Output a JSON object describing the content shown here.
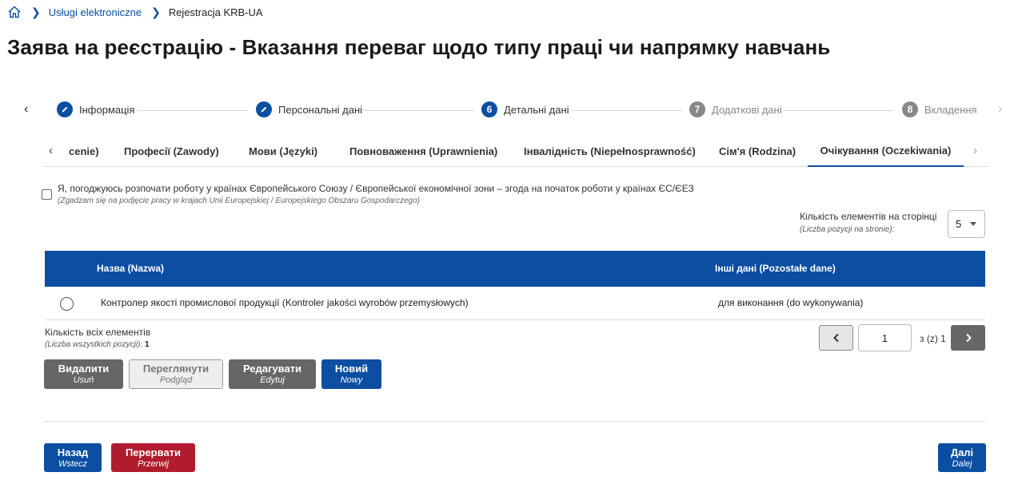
{
  "breadcrumb": {
    "items": [
      "Usługi elektroniczne",
      "Rejestracja KRB-UA"
    ]
  },
  "page_title": "Заява на реєстрацію - Вказання переваг щодо типу праці чи напрямку навчань",
  "stepper": {
    "steps": [
      {
        "num": "",
        "label": "Інформація",
        "state": "done"
      },
      {
        "num": "",
        "label": "Персональні дані",
        "state": "done"
      },
      {
        "num": "6",
        "label": "Детальні дані",
        "state": "active"
      },
      {
        "num": "7",
        "label": "Додаткові дані",
        "state": "pending"
      },
      {
        "num": "8",
        "label": "Вкладення",
        "state": "pending"
      }
    ]
  },
  "tabs": {
    "items": [
      "cenie)",
      "Професії (Zawody)",
      "Мови (Języki)",
      "Повноваження (Uprawnienia)",
      "Інвалідність (Niepełnosprawność)",
      "Сім'я (Rodzina)",
      "Очікування (Oczekiwania)"
    ],
    "active_index": 6
  },
  "consent": {
    "label": "Я, погоджуюсь розпочати роботу у країнах Європейського Союзу / Європейської економічної зони – згода на початок роботи у країнах ЄС/ЄЕЗ",
    "label_pl": "(Zgadzam się na podjęcie pracy w krajach Unii Europejskiej / Europejskiego Obszaru Gospodarczego)",
    "checked": false
  },
  "per_page": {
    "label": "Кількість елементів на сторінці",
    "label_pl": "(Liczba pozycji na stronie):",
    "value": "5"
  },
  "table": {
    "columns": [
      "Назва (Nazwa)",
      "Інші дані (Pozostałe dane)"
    ],
    "rows": [
      {
        "name": "Контролер якості промислової продукції (Kontroler jakości wyrobów przemysłowych)",
        "other": "для виконання (do wykonywania)"
      }
    ]
  },
  "total": {
    "label": "Кількість всіх елементів",
    "label_pl": "(Liczba wszystkich pozycji):",
    "count": "1"
  },
  "pagination": {
    "current": "1",
    "of_label": "з (z) 1"
  },
  "actions": {
    "delete": {
      "label": "Видалити",
      "label_pl": "Usuń"
    },
    "view": {
      "label": "Переглянути",
      "label_pl": "Podgląd"
    },
    "edit": {
      "label": "Редагувати",
      "label_pl": "Edytuj"
    },
    "new": {
      "label": "Новий",
      "label_pl": "Nowy"
    }
  },
  "nav": {
    "back": {
      "label": "Назад",
      "label_pl": "Wstecz"
    },
    "abort": {
      "label": "Перервати",
      "label_pl": "Przerwij"
    },
    "next": {
      "label": "Далі",
      "label_pl": "Dalej"
    }
  },
  "colors": {
    "primary": "#0b4ea2",
    "danger": "#b01c2e",
    "neutral": "#666666"
  }
}
